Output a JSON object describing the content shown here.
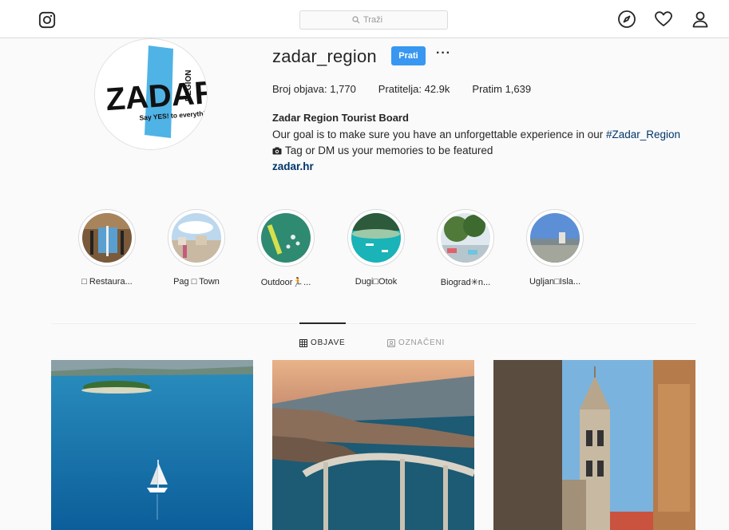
{
  "nav": {
    "search_placeholder": "Traži",
    "logo_icon": "instagram-icon",
    "icons": [
      "compass-icon",
      "heart-icon",
      "user-icon"
    ]
  },
  "profile": {
    "username": "zadar_region",
    "follow_label": "Prati",
    "more_label": "···",
    "stats": {
      "posts": "Broj objava: 1,770",
      "followers": "Pratitelja: 42.9k",
      "following": "Pratim 1,639"
    },
    "bio_name": "Zadar Region Tourist Board",
    "bio_line1_text": "Our goal is to make sure you have an unforgettable experience in our ",
    "bio_hashtag": "#Zadar_Region",
    "bio_line2": "Tag or DM us your memories to be featured",
    "bio_link": "zadar.hr",
    "avatar_logo_text": "ZADAR",
    "avatar_region_text": "REGION",
    "avatar_slogan": "Say YES! to everything"
  },
  "highlights": [
    {
      "label": "□ Restaura..."
    },
    {
      "label": "Pag □ Town"
    },
    {
      "label": "Outdoor🏃..."
    },
    {
      "label": "Dugi□Otok"
    },
    {
      "label": "Biograd✳n..."
    },
    {
      "label": "Ugljan□Isla..."
    }
  ],
  "tabs": {
    "posts": "OBJAVE",
    "tagged": "OZNAČENI"
  },
  "colors": {
    "accent": "#3897f0",
    "link": "#003569",
    "text": "#262626",
    "border": "#dbdbdb"
  }
}
